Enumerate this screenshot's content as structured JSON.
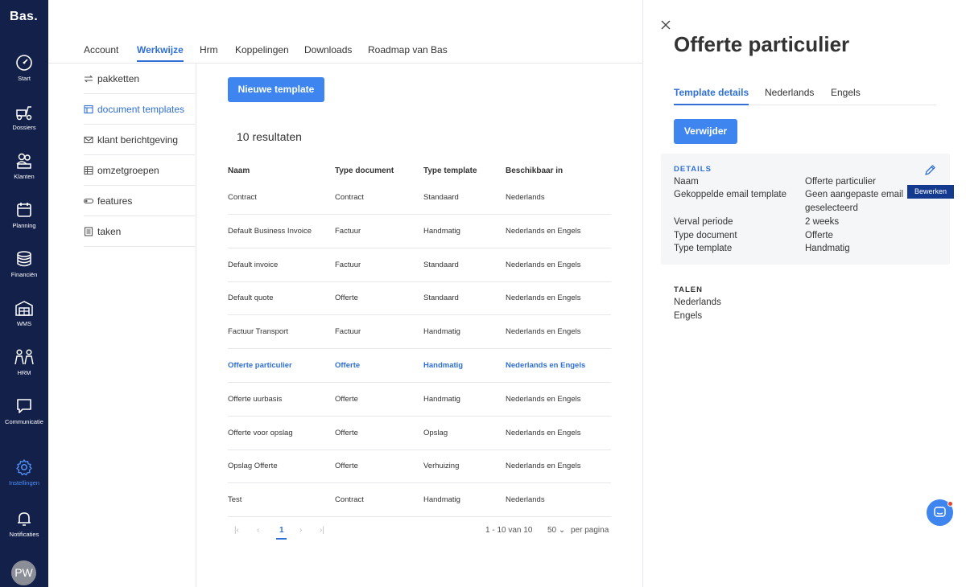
{
  "app": {
    "logo": "Bas."
  },
  "nav": [
    {
      "label": "Start",
      "icon": "dashboard-icon"
    },
    {
      "label": "Dossiers",
      "icon": "scooter-icon"
    },
    {
      "label": "Klanten",
      "icon": "people-icon"
    },
    {
      "label": "Planning",
      "icon": "calendar-icon"
    },
    {
      "label": "Financiën",
      "icon": "coins-icon"
    },
    {
      "label": "WMS",
      "icon": "warehouse-icon"
    },
    {
      "label": "HRM",
      "icon": "team-icon"
    },
    {
      "label": "Communicatie",
      "icon": "chat-bubble-icon"
    },
    {
      "label": "Instellingen",
      "icon": "gear-icon",
      "active": true
    },
    {
      "label": "Notificaties",
      "icon": "bell-icon"
    }
  ],
  "user": {
    "initials": "PW"
  },
  "top_tabs": [
    "Account",
    "Werkwijze",
    "Hrm",
    "Koppelingen",
    "Downloads",
    "Roadmap van Bas"
  ],
  "active_top_tab": "Werkwijze",
  "sub_menu": [
    {
      "label": "pakketten",
      "icon": "arrows-icon"
    },
    {
      "label": "document templates",
      "icon": "template-icon",
      "active": true
    },
    {
      "label": "klant berichtgeving",
      "icon": "envelope-icon"
    },
    {
      "label": "omzetgroepen",
      "icon": "table-icon"
    },
    {
      "label": "features",
      "icon": "toggle-icon"
    },
    {
      "label": "taken",
      "icon": "checklist-icon"
    }
  ],
  "main": {
    "new_button": "Nieuwe template",
    "results": "10 resultaten",
    "columns": [
      "Naam",
      "Type document",
      "Type template",
      "Beschikbaar in"
    ],
    "rows": [
      [
        "Contract",
        "Contract",
        "Standaard",
        "Nederlands"
      ],
      [
        "Default Business Invoice",
        "Factuur",
        "Handmatig",
        "Nederlands en Engels"
      ],
      [
        "Default invoice",
        "Factuur",
        "Standaard",
        "Nederlands en Engels"
      ],
      [
        "Default quote",
        "Offerte",
        "Standaard",
        "Nederlands en Engels"
      ],
      [
        "Factuur Transport",
        "Factuur",
        "Handmatig",
        "Nederlands en Engels"
      ],
      [
        "Offerte particulier",
        "Offerte",
        "Handmatig",
        "Nederlands en Engels"
      ],
      [
        "Offerte uurbasis",
        "Offerte",
        "Handmatig",
        "Nederlands en Engels"
      ],
      [
        "Offerte voor opslag",
        "Offerte",
        "Opslag",
        "Nederlands en Engels"
      ],
      [
        "Opslag Offerte",
        "Offerte",
        "Verhuizing",
        "Nederlands en Engels"
      ],
      [
        "Test",
        "Contract",
        "Handmatig",
        "Nederlands"
      ]
    ],
    "selected_row": 5,
    "pagination": {
      "first": "|‹",
      "prev": "‹",
      "page": "1",
      "next": "›",
      "last": "›|",
      "range": "1 - 10 van 10",
      "per_page": "50",
      "per_page_label": "per pagina"
    }
  },
  "panel": {
    "title": "Offerte particulier",
    "tabs": [
      "Template details",
      "Nederlands",
      "Engels"
    ],
    "delete_button": "Verwijder",
    "details_heading": "DETAILS",
    "details": [
      {
        "label": "Naam",
        "value": "Offerte particulier"
      },
      {
        "label": "Gekoppelde email template",
        "value": "Geen aangepaste email",
        "value2": "geselecteerd"
      },
      {
        "label": "Verval periode",
        "value": "2 weeks"
      },
      {
        "label": "Type document",
        "value": "Offerte"
      },
      {
        "label": "Type template",
        "value": "Handmatig"
      }
    ],
    "edit_tooltip": "Bewerken",
    "languages_heading": "TALEN",
    "languages": [
      "Nederlands",
      "Engels"
    ]
  },
  "colors": {
    "nav_bg": "#13204a",
    "accent": "#3f85f0",
    "link": "#2f6fd6"
  }
}
